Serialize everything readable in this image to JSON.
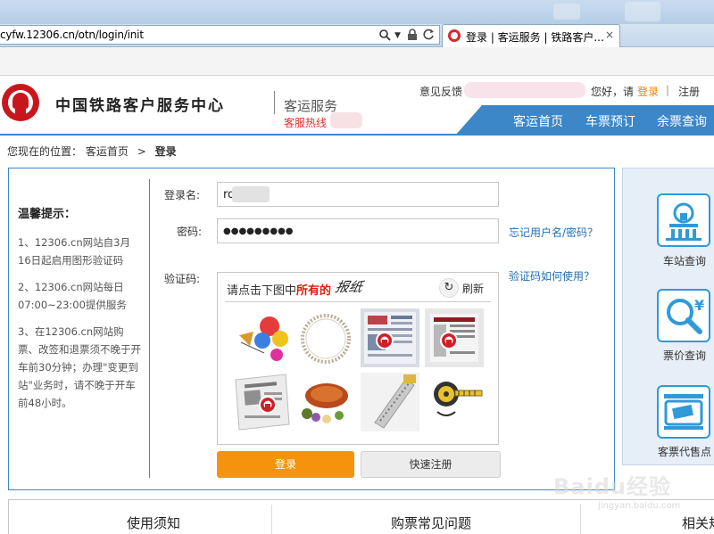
{
  "browser": {
    "address": "cyfw.12306.cn/otn/login/init",
    "tab_title": "登录 | 客运服务 | 铁路客户...",
    "tab_close": "×"
  },
  "header": {
    "site_name": "中国铁路客户服务中心",
    "sub_title": "客运服务",
    "hotline": "客服热线",
    "feedback": "意见反馈",
    "greeting": "您好，请",
    "login": "登录",
    "separator": "|",
    "register": "注册",
    "nav": [
      "客运首页",
      "车票预订",
      "余票查询"
    ]
  },
  "breadcrumb": {
    "prefix": "您现在的位置：",
    "home": "客运首页",
    "arrow": ">",
    "current": "登录"
  },
  "tips": {
    "title": "温馨提示：",
    "items": [
      "1、12306.cn网站自3月16日起启用图形验证码",
      "2、12306.cn网站每日07:00~23:00提供服务",
      "3、在12306.cn网站购票、改签和退票须不晚于开车前30分钟；办理\"变更到站\"业务时，请不晚于开车前48小时。"
    ]
  },
  "form": {
    "username_label": "登录名:",
    "username_value": "ro",
    "password_label": "密码:",
    "password_value": "●●●●●●●●●",
    "forgot": "忘记用户名/密码？",
    "captcha_label": "验证码:",
    "captcha_help": "验证码如何使用？"
  },
  "captcha": {
    "prompt_pre": "请点击下图中",
    "prompt_red": "所有的",
    "target_word": "报纸",
    "refresh": "刷新",
    "tiles": [
      "balloons",
      "ring",
      "newspaper",
      "newspaper",
      "newspaper",
      "roast-duck",
      "tape-measure",
      "tape-measure"
    ]
  },
  "buttons": {
    "login": "登录",
    "quick_register": "快速注册"
  },
  "right_panel": [
    {
      "label": "车站查询",
      "icon": "station-icon"
    },
    {
      "label": "票价查询",
      "icon": "price-search-icon"
    },
    {
      "label": "客票代售点",
      "icon": "ticket-agent-icon"
    }
  ],
  "bottom_tabs": [
    "使用须知",
    "购票常见问题",
    "相关规"
  ],
  "watermark": {
    "text": "Baidu经验",
    "sub": "jingyan.baidu.com"
  },
  "colors": {
    "accent_blue": "#3b87c8",
    "login_orange": "#f6930e",
    "brand_red": "#c8161d"
  }
}
